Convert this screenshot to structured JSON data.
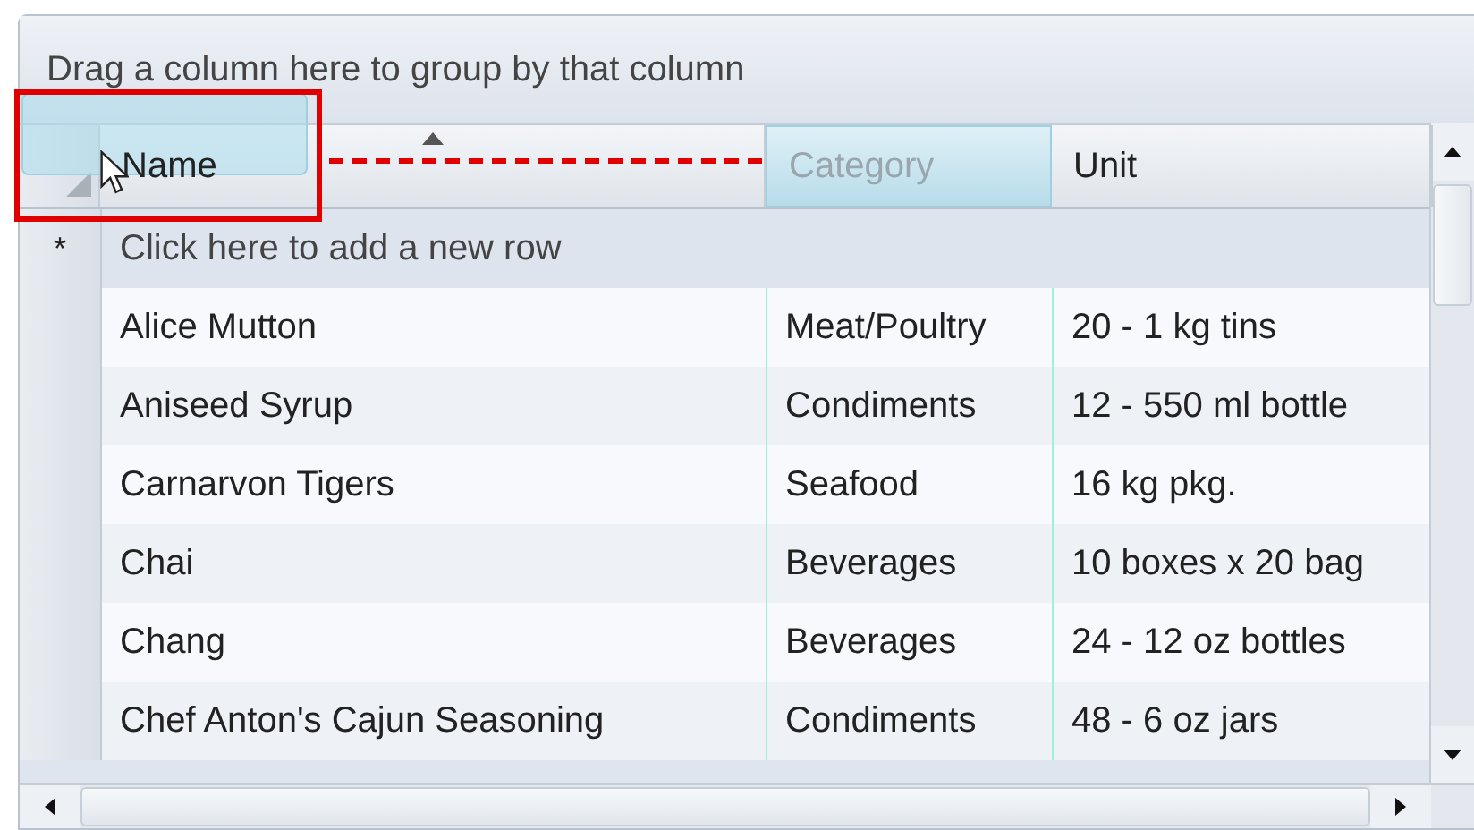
{
  "group_panel": {
    "hint": "Drag a column here to group by that column"
  },
  "columns": [
    {
      "label": "Name",
      "sorted_ascending": true,
      "dragging": true,
      "drop_target": false
    },
    {
      "label": "Category",
      "sorted_ascending": false,
      "dragging": false,
      "drop_target": true
    },
    {
      "label": "Unit",
      "sorted_ascending": false,
      "dragging": false,
      "drop_target": false
    }
  ],
  "new_row": {
    "marker": "*",
    "label": "Click here to add a new row"
  },
  "rows": [
    [
      "Alice Mutton",
      "Meat/Poultry",
      "20 - 1 kg tins"
    ],
    [
      "Aniseed Syrup",
      "Condiments",
      "12 - 550 ml bottle"
    ],
    [
      "Carnarvon Tigers",
      "Seafood",
      "16 kg pkg."
    ],
    [
      "Chai",
      "Beverages",
      "10 boxes x 20 bag"
    ],
    [
      "Chang",
      "Beverages",
      "24 - 12 oz bottles"
    ],
    [
      "Chef Anton's Cajun Seasoning",
      "Condiments",
      "48 - 6 oz jars"
    ]
  ]
}
